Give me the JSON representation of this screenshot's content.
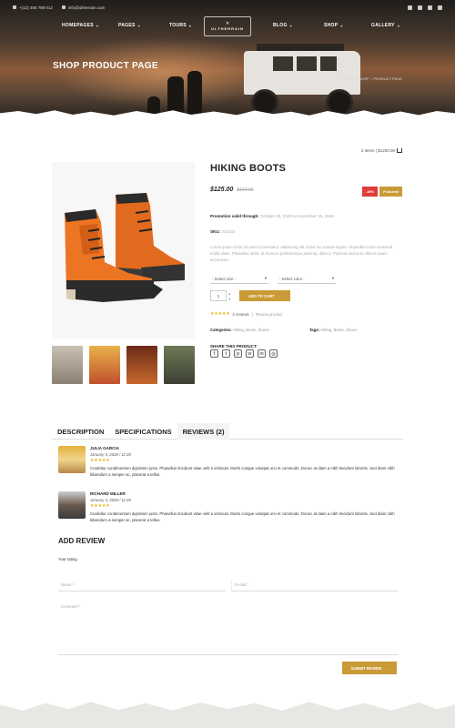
{
  "topbar": {
    "phone": "+(12) 456 789 012",
    "email": "info@ultherrain.com"
  },
  "nav": {
    "items": [
      "HOMEPAGES",
      "PAGES",
      "TOURS",
      "BLOG",
      "SHOP",
      "GALLERY"
    ],
    "logo_name": "ULTHERRAIN"
  },
  "hero": {
    "title": "SHOP PRODUCT PAGE",
    "breadcrumb": [
      "HOME",
      "SHOP",
      "PRODUCT PAGE"
    ]
  },
  "cart": {
    "label": "2 items | $1250.00"
  },
  "product": {
    "title": "HIKING BOOTS",
    "price": "$125.00",
    "old_price": "$160.00",
    "badge_sale": "-15%",
    "badge_featured": "Featured",
    "promo_label": "Promotion valid through:",
    "promo_dates": "October 30, 2028 to November 15, 2028",
    "sku_label": "SKU:",
    "sku_value": "315133",
    "description": "Lorem ipsum dolor sit amet consectetur, adipiscing elit. Dolor leo massa sapien. Imperdiet morbi euismod mollis diam. Phasellus amet, at rhoncus pellentesque pulvinar, diam a. Pulvinar sed eros ultrices quam accumsan.",
    "select_size": "- Select size -",
    "select_color": "- Select color -",
    "quantity": "1",
    "add_to_cart": "ADD TO CART",
    "reviews_count": "2 reviews",
    "review_link": "Review product",
    "categories_label": "Categories:",
    "categories": "Hiking, Boots, Shoes",
    "tags_label": "Tags:",
    "tags": "Hiking, Boots, Shoes",
    "share_label": "SHARE THIS PRODUCT:"
  },
  "tabs": [
    "DESCRIPTION",
    "SPECIFICATIONS",
    "REVIEWS (2)"
  ],
  "reviews": [
    {
      "name": "JULIA GARCIA",
      "date": "January 4, 2026 / 11:30",
      "text": "Curabitur condimentum dignissim justo. Phasellus tincidunt vitae velit a vehicula. Morbi congue volutpat orci et commodo. Donec at diam a nibh tincidunt lobortis. Sed diam nibh bibendum a semper ac, placerat a tellus."
    },
    {
      "name": "RICHARD MILLER",
      "date": "January 4, 2026 / 11:30",
      "text": "Curabitur condimentum dignissim justo. Phasellus tincidunt vitae velit a vehicula. Morbi congue volutpat orci et commodo. Donec at diam a nibh tincidunt lobortis. Sed diam nibh bibendum a semper ac, placerat a tellus."
    }
  ],
  "review_form": {
    "heading": "ADD REVIEW",
    "your_rating": "Your rating",
    "name_placeholder": "Name *",
    "email_placeholder": "E-mail *",
    "comment_placeholder": "Comment *",
    "submit": "SUBMIT REVIEW"
  },
  "colors": {
    "accent": "#c99a35",
    "sale": "#e23b3b",
    "star": "#e8b21c"
  }
}
